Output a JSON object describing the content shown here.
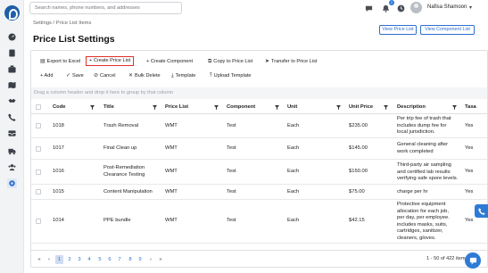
{
  "search": {
    "placeholder": "Search names, phone numbers, and addresses"
  },
  "user": {
    "name": "Nafisa Shamoon"
  },
  "notifications": {
    "count": "1"
  },
  "breadcrumb": "Settings / Price List Items",
  "page_title": "Price List Settings",
  "header_buttons": {
    "view_price_list": "View Price List",
    "view_component_list": "View Component List"
  },
  "toolbar": {
    "export_excel": "Export to Excel",
    "create_price_list": "+ Create Price List",
    "create_component": "+ Create Component",
    "copy_to_price_list": "Copy to Price List",
    "transfer_to_price_list": "Transfer to Price List",
    "add": "+ Add",
    "save": "Save",
    "cancel": "Cancel",
    "bulk_delete": "Bulk Delete",
    "template": "Template",
    "upload_template": "Upload Template"
  },
  "group_hint": "Drag a column header and drop it here to group by that column",
  "columns": [
    "Code",
    "Title",
    "Price List",
    "Component",
    "Unit",
    "Unit Price",
    "Description",
    "Taxa"
  ],
  "rows": [
    {
      "code": "1018",
      "title": [
        "Trash Removal"
      ],
      "price_list": "WMT",
      "component": "Test",
      "unit": "Each",
      "unit_price": "$235.00",
      "description": [
        "Per trip fee of trash that",
        "includes dump fee for",
        "local jurisdiction."
      ],
      "taxable": "Yes"
    },
    {
      "code": "1017",
      "title": [
        "Final Clean up"
      ],
      "price_list": "WMT",
      "component": "Test",
      "unit": "Each",
      "unit_price": "$145.00",
      "description": [
        "General cleaning after",
        "work completed"
      ],
      "taxable": "Yes"
    },
    {
      "code": "1016",
      "title": [
        "Post-Remediation",
        "Clearance Testing"
      ],
      "price_list": "WMT",
      "component": "Test",
      "unit": "Each",
      "unit_price": "$150.00",
      "description": [
        "Third-party air sampling",
        "and certified lab results",
        "verifying safe spore levels."
      ],
      "taxable": "Yes"
    },
    {
      "code": "1015",
      "title": [
        "Content Manipulation"
      ],
      "price_list": "WMT",
      "component": "Test",
      "unit": "Each",
      "unit_price": "$75.00",
      "description": [
        "charge per hr"
      ],
      "taxable": "Yes"
    },
    {
      "code": "1014",
      "title": [
        "PPE bundle"
      ],
      "price_list": "WMT",
      "component": "Test",
      "unit": "Each",
      "unit_price": "$42.15",
      "description": [
        "Protective equipment",
        "allocation for each job,",
        "per day, per employee.",
        "includes masks, suits,",
        "cartridges, sanitizer,",
        "cleaners, gloves."
      ],
      "taxable": "Yes"
    }
  ],
  "pagination": {
    "first": "«",
    "prev": "‹",
    "next": "›",
    "last": "»",
    "pages": [
      "1",
      "2",
      "3",
      "4",
      "5",
      "6",
      "7",
      "8",
      "9"
    ],
    "current": "1",
    "info": "1 - 50 of 422 item"
  }
}
